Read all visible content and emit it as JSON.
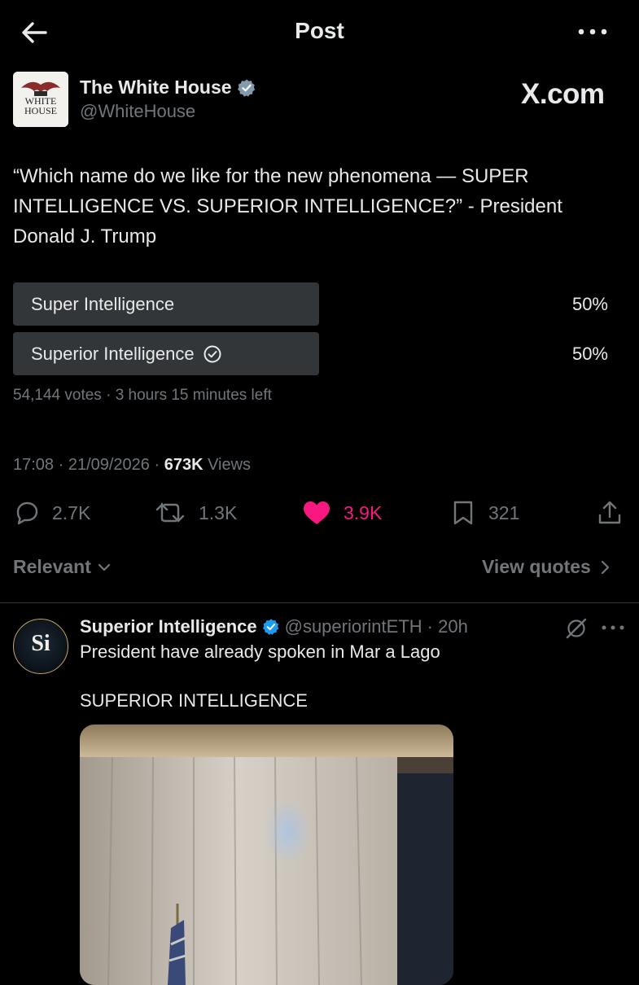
{
  "header": {
    "title": "Post"
  },
  "post": {
    "author_name": "The White House",
    "author_handle": "@WhiteHouse",
    "logo_text_line1": "WHITE",
    "logo_text_line2": "HOUSE",
    "watermark": "X.com",
    "text": "“Which name do we like for the new phenomena — SUPER INTELLIGENCE VS. SUPERIOR INTELLIGENCE?” - President Donald J. Trump",
    "poll": {
      "options": [
        {
          "label": "Super Intelligence",
          "percent": "50%",
          "share": 0.5,
          "selected": false
        },
        {
          "label": "Superior Intelligence",
          "percent": "50%",
          "share": 0.5,
          "selected": true
        }
      ],
      "meta": "54,144 votes · 3 hours 15 minutes left"
    },
    "timestamp": "17:08 · 21/09/2026 · ",
    "views_count": "673K",
    "views_label": " Views",
    "actions": {
      "replies": "2.7K",
      "reposts": "1.3K",
      "likes": "3.9K",
      "bookmarks": "321"
    }
  },
  "sort": {
    "label": "Relevant",
    "view_quotes": "View quotes"
  },
  "reply": {
    "avatar_text": "Si",
    "author_name": "Superior Intelligence",
    "author_handle": "@superiorintETH",
    "time": "· 20h",
    "text1": "President have already spoken in Mar a Lago",
    "text2": "SUPERIOR INTELLIGENCE"
  },
  "colors": {
    "verified": "#1d9bf0",
    "like": "#f91880",
    "muted": "#71767b"
  }
}
